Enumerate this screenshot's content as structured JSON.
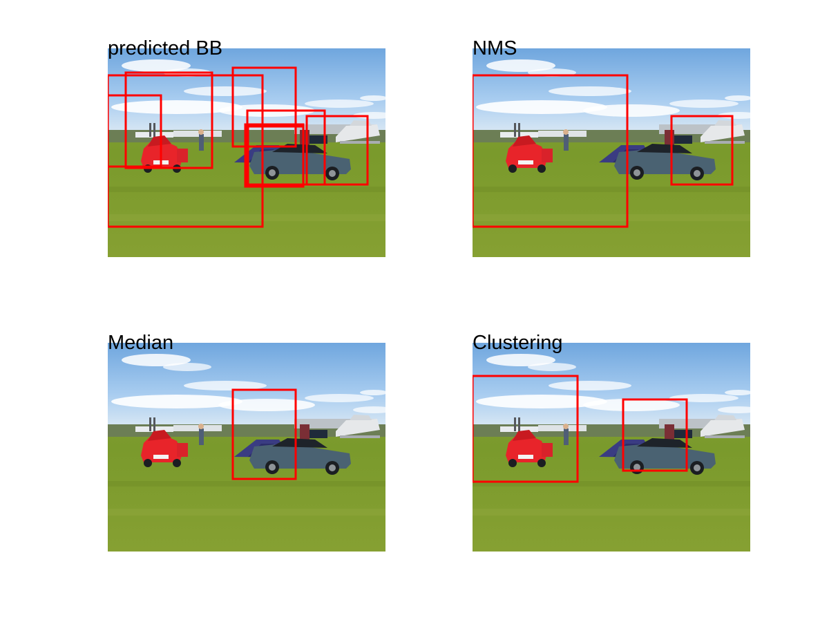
{
  "panels": [
    {
      "title": "predicted BB",
      "box_count": 8
    },
    {
      "title": "NMS",
      "box_count": 2
    },
    {
      "title": "Median",
      "box_count": 1
    },
    {
      "title": "Clustering",
      "box_count": 2
    }
  ],
  "colors": {
    "box": "#ff0000",
    "sky": "#8fbbe6",
    "grass": "#7d9a2e",
    "red_car": "#e8242a",
    "blue_car": "#4a6272",
    "tent": "#3a3c82"
  }
}
